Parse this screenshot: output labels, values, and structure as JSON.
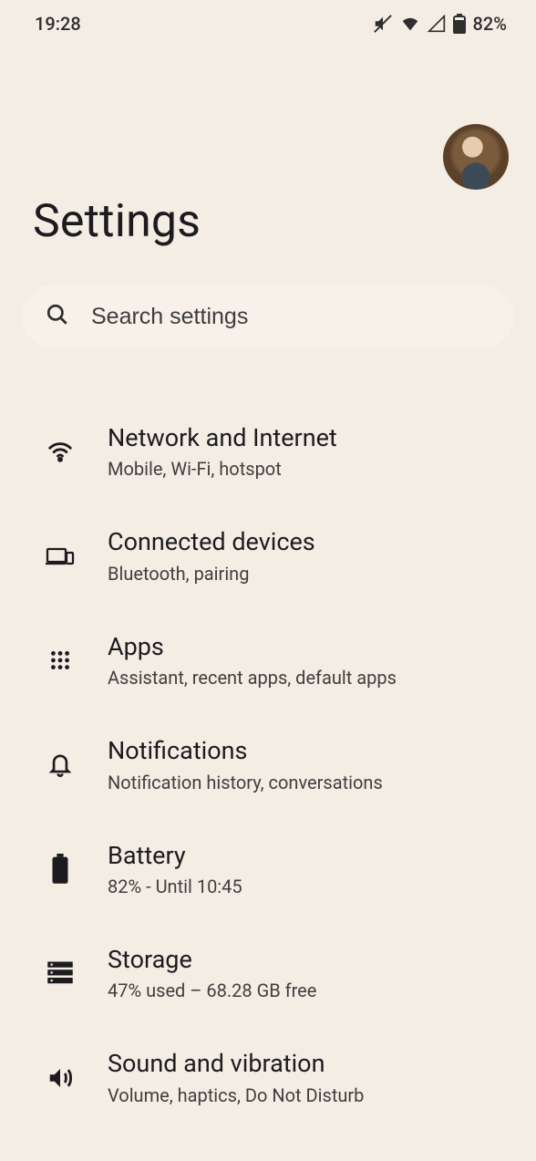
{
  "status": {
    "time": "19:28",
    "battery_pct": "82%"
  },
  "page_title": "Settings",
  "search": {
    "placeholder": "Search settings"
  },
  "items": [
    {
      "icon": "wifi",
      "title": "Network and Internet",
      "subtitle": "Mobile, Wi-Fi, hotspot"
    },
    {
      "icon": "devices",
      "title": "Connected devices",
      "subtitle": "Bluetooth, pairing"
    },
    {
      "icon": "apps",
      "title": "Apps",
      "subtitle": "Assistant, recent apps, default apps"
    },
    {
      "icon": "bell",
      "title": "Notifications",
      "subtitle": "Notification history, conversations"
    },
    {
      "icon": "battery",
      "title": "Battery",
      "subtitle": "82% - Until 10:45"
    },
    {
      "icon": "storage",
      "title": "Storage",
      "subtitle": "47% used – 68.28 GB free"
    },
    {
      "icon": "sound",
      "title": "Sound and vibration",
      "subtitle": "Volume, haptics, Do Not Disturb"
    }
  ]
}
